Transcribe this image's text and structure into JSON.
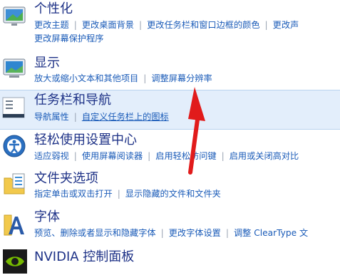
{
  "categories": [
    {
      "title": "个性化",
      "links": [
        "更改主题",
        "更改桌面背景",
        "更改任务栏和窗口边框的颜色",
        "更改声"
      ],
      "links_line2": [
        "更改屏幕保护程序"
      ]
    },
    {
      "title": "显示",
      "links": [
        "放大或缩小文本和其他项目",
        "调整屏幕分辨率"
      ]
    },
    {
      "title": "任务栏和导航",
      "links": [
        "导航属性",
        "自定义任务栏上的图标"
      ]
    },
    {
      "title": "轻松使用设置中心",
      "links": [
        "适应弱视",
        "使用屏幕阅读器",
        "启用轻松访问键",
        "启用或关闭高对比"
      ]
    },
    {
      "title": "文件夹选项",
      "links": [
        "指定单击或双击打开",
        "显示隐藏的文件和文件夹"
      ]
    },
    {
      "title": "字体",
      "links": [
        "预览、删除或者显示和隐藏字体",
        "更改字体设置",
        "调整 ClearType 文"
      ]
    },
    {
      "title": "NVIDIA 控制面板",
      "links": []
    }
  ],
  "colors": {
    "title": "#1e3287",
    "link": "#1a5bb8",
    "highlight": "#e3eefb",
    "arrow": "#e11b1b"
  }
}
